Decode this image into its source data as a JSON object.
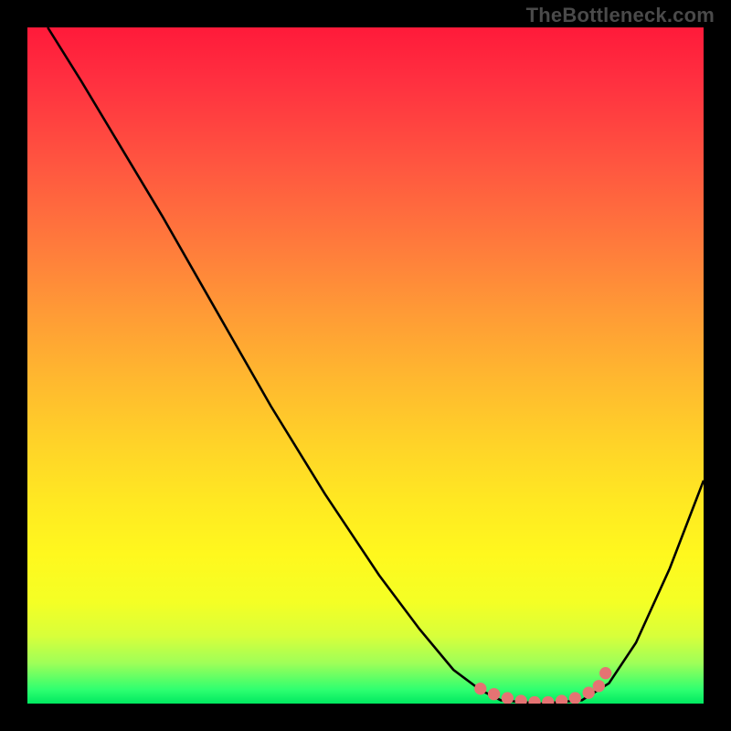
{
  "watermark": "TheBottleneck.com",
  "chart_data": {
    "type": "line",
    "title": "",
    "xlabel": "",
    "ylabel": "",
    "xlim": [
      0,
      100
    ],
    "ylim": [
      0,
      100
    ],
    "grid": false,
    "legend": false,
    "gradient_stops": [
      {
        "pos": 0,
        "color": "#ff1a3a"
      },
      {
        "pos": 8,
        "color": "#ff3040"
      },
      {
        "pos": 20,
        "color": "#ff5540"
      },
      {
        "pos": 32,
        "color": "#ff7a3c"
      },
      {
        "pos": 42,
        "color": "#ff9a36"
      },
      {
        "pos": 52,
        "color": "#ffb82f"
      },
      {
        "pos": 62,
        "color": "#ffd428"
      },
      {
        "pos": 70,
        "color": "#ffe822"
      },
      {
        "pos": 78,
        "color": "#fff81e"
      },
      {
        "pos": 85,
        "color": "#f4ff25"
      },
      {
        "pos": 90,
        "color": "#d8ff3a"
      },
      {
        "pos": 94,
        "color": "#9fff58"
      },
      {
        "pos": 98,
        "color": "#2dff70"
      },
      {
        "pos": 100,
        "color": "#00e860"
      }
    ],
    "series": [
      {
        "name": "bottleneck-curve",
        "color": "#000000",
        "points": [
          {
            "x": 3,
            "y": 100
          },
          {
            "x": 8,
            "y": 92
          },
          {
            "x": 14,
            "y": 82
          },
          {
            "x": 20,
            "y": 72
          },
          {
            "x": 28,
            "y": 58
          },
          {
            "x": 36,
            "y": 44
          },
          {
            "x": 44,
            "y": 31
          },
          {
            "x": 52,
            "y": 19
          },
          {
            "x": 58,
            "y": 11
          },
          {
            "x": 63,
            "y": 5
          },
          {
            "x": 67,
            "y": 2
          },
          {
            "x": 70,
            "y": 0.5
          },
          {
            "x": 76,
            "y": 0
          },
          {
            "x": 82,
            "y": 0.5
          },
          {
            "x": 86,
            "y": 3
          },
          {
            "x": 90,
            "y": 9
          },
          {
            "x": 95,
            "y": 20
          },
          {
            "x": 100,
            "y": 33
          }
        ]
      },
      {
        "name": "marker-dots",
        "color": "#e57373",
        "points": [
          {
            "x": 67,
            "y": 2.2
          },
          {
            "x": 69,
            "y": 1.4
          },
          {
            "x": 71,
            "y": 0.8
          },
          {
            "x": 73,
            "y": 0.4
          },
          {
            "x": 75,
            "y": 0.2
          },
          {
            "x": 77,
            "y": 0.2
          },
          {
            "x": 79,
            "y": 0.4
          },
          {
            "x": 81,
            "y": 0.8
          },
          {
            "x": 83,
            "y": 1.6
          },
          {
            "x": 84.5,
            "y": 2.6
          },
          {
            "x": 85.5,
            "y": 4.5
          }
        ]
      }
    ]
  }
}
